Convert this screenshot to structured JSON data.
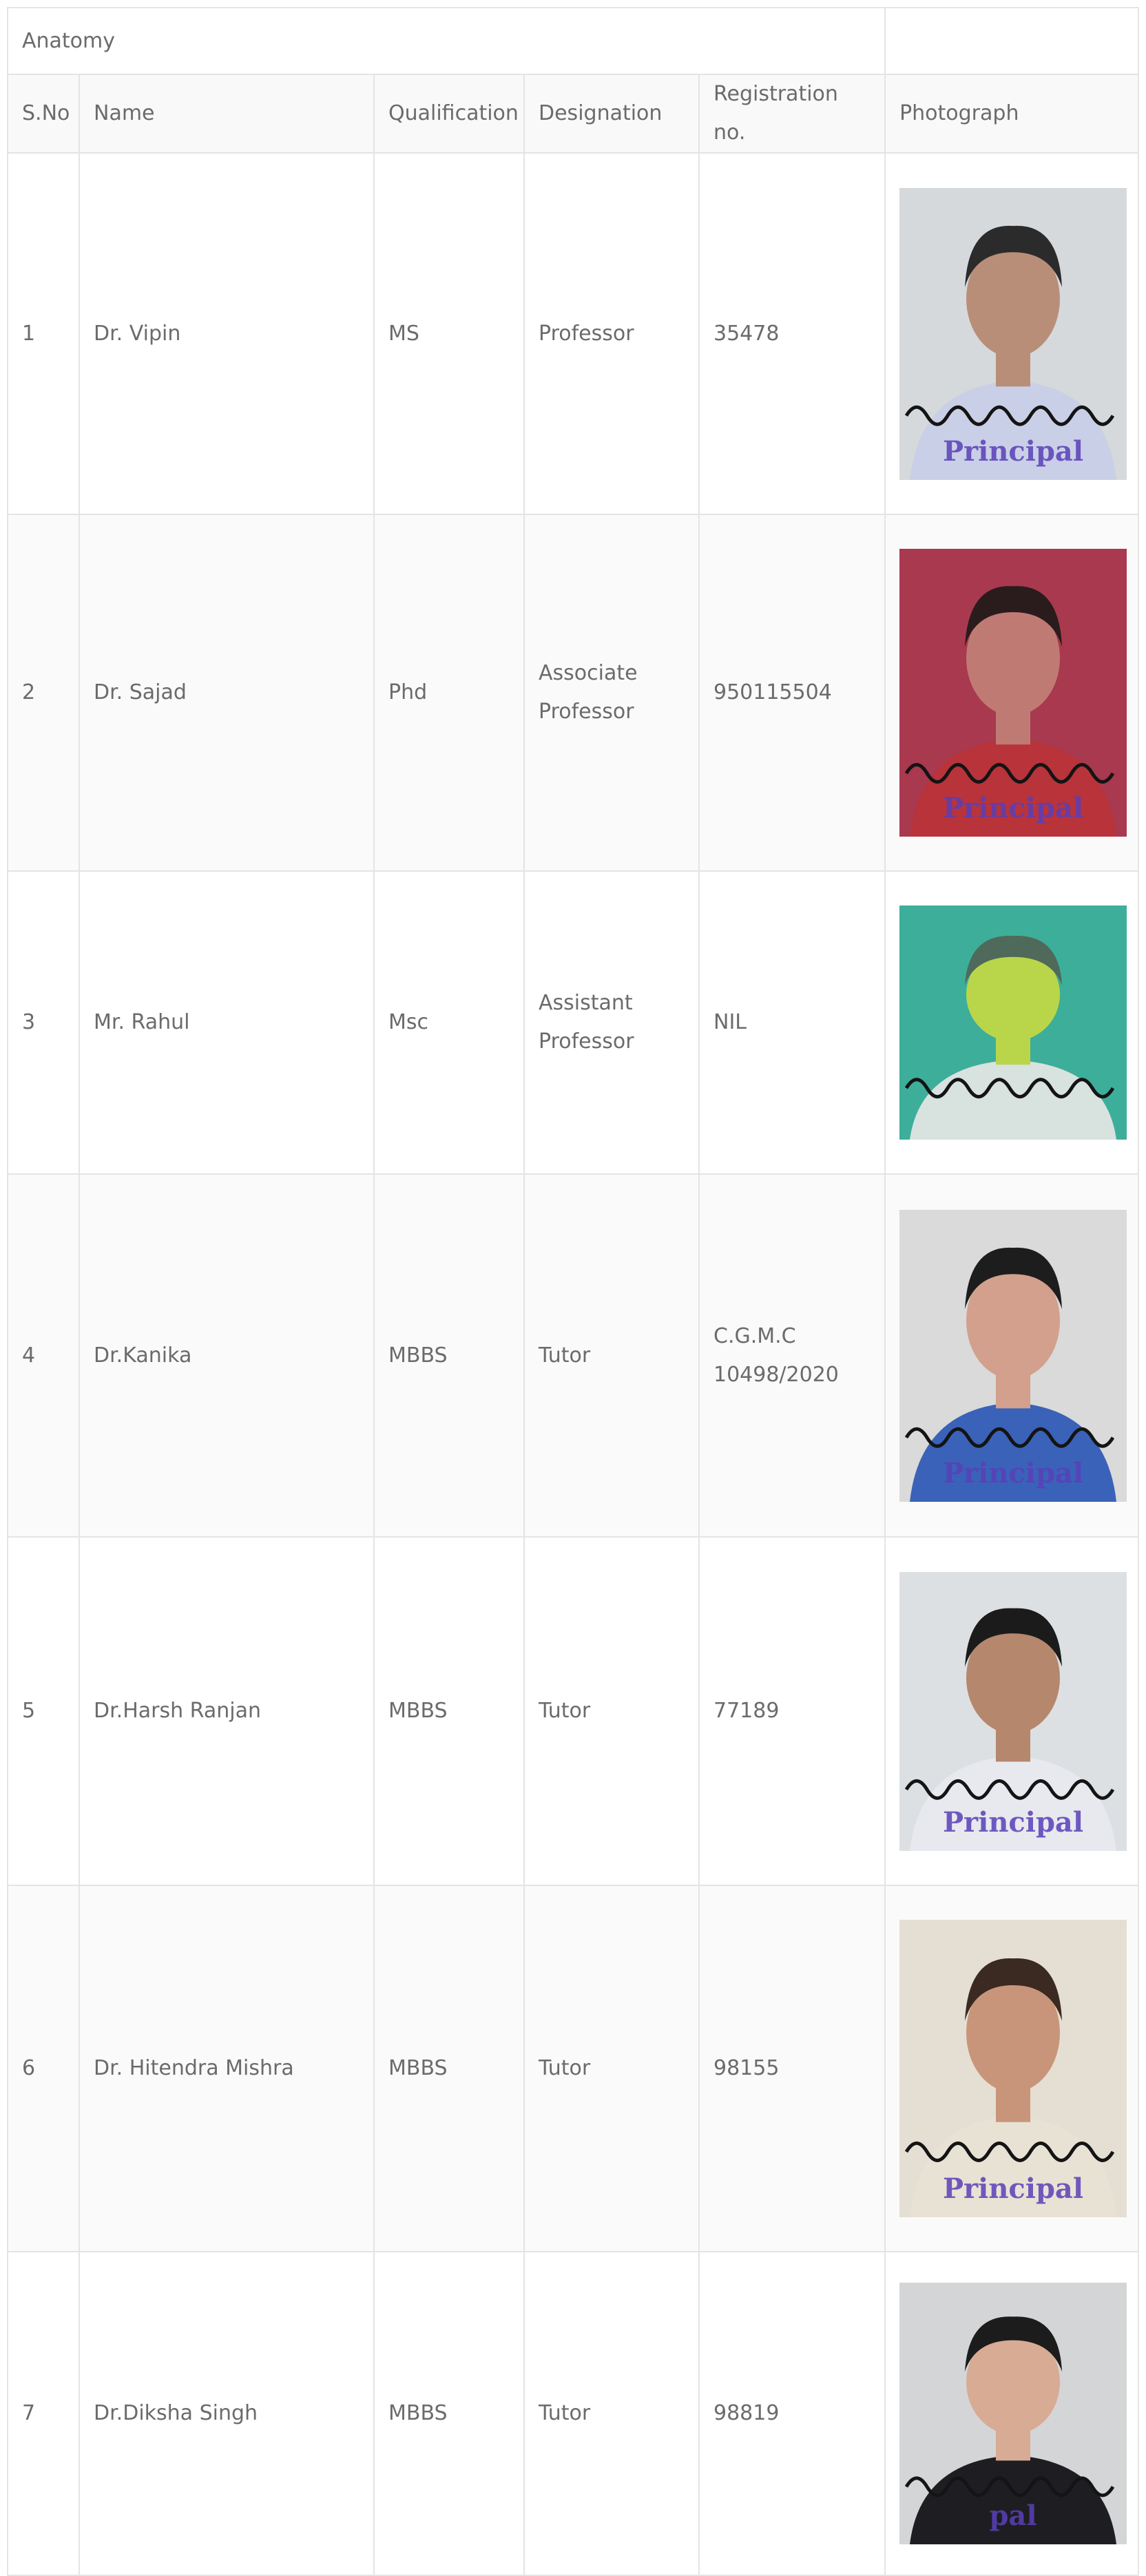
{
  "section_title": "Anatomy",
  "headers": [
    "S.No",
    "Name",
    "Qualification",
    "Designation",
    "Registration no.",
    "Photograph"
  ],
  "rows": [
    {
      "sno": "1",
      "name": "Dr. Vipin",
      "qualification": "MS",
      "designation": "Professor",
      "registration": "35478",
      "photo": {
        "bg": "#d6d9dc",
        "shirt": "#c9cfe6",
        "hair": "#2b2b2b",
        "skin": "#b98e78",
        "stamp": "Principal"
      }
    },
    {
      "sno": "2",
      "name": "Dr. Sajad",
      "qualification": "Phd",
      "designation": "Associate\nProfessor",
      "registration": "950115504",
      "photo": {
        "bg": "#a8394f",
        "shirt": "#b8333a",
        "hair": "#2a1c1c",
        "skin": "#c07a74",
        "stamp": "Principal"
      }
    },
    {
      "sno": "3",
      "name": "Mr. Rahul",
      "qualification": "Msc",
      "designation": "Assistant\nProfessor",
      "registration": "NIL",
      "photo": {
        "bg": "#3dae9a",
        "shirt": "#d8e2df",
        "hair": "#4f6a5a",
        "skin": "#b9d64a",
        "stamp": ""
      }
    },
    {
      "sno": "4",
      "name": "Dr.Kanika",
      "qualification": "MBBS",
      "designation": "Tutor",
      "registration": "C.G.M.C\n10498/2020",
      "photo": {
        "bg": "#d9dad9",
        "shirt": "#3a62b8",
        "hair": "#1d1d1d",
        "skin": "#d2a08c",
        "stamp": "Principal"
      }
    },
    {
      "sno": "5",
      "name": "Dr.Harsh Ranjan",
      "qualification": "MBBS",
      "designation": "Tutor",
      "registration": "77189",
      "photo": {
        "bg": "#dde0e3",
        "shirt": "#e7e9ee",
        "hair": "#1b1b1b",
        "skin": "#b5876c",
        "stamp": "Principal"
      }
    },
    {
      "sno": "6",
      "name": "Dr. Hitendra Mishra",
      "qualification": "MBBS",
      "designation": "Tutor",
      "registration": "98155",
      "photo": {
        "bg": "#e4dfd2",
        "shirt": "#e8e2d4",
        "hair": "#3b2a22",
        "skin": "#c9957a",
        "stamp": "Principal"
      }
    },
    {
      "sno": "7",
      "name": "Dr.Diksha Singh",
      "qualification": "MBBS",
      "designation": "Tutor",
      "registration": "98819",
      "photo": {
        "bg": "#d4d5d6",
        "shirt": "#1e1e22",
        "hair": "#1c1c1c",
        "skin": "#d8ab95",
        "stamp": "pal"
      }
    }
  ]
}
